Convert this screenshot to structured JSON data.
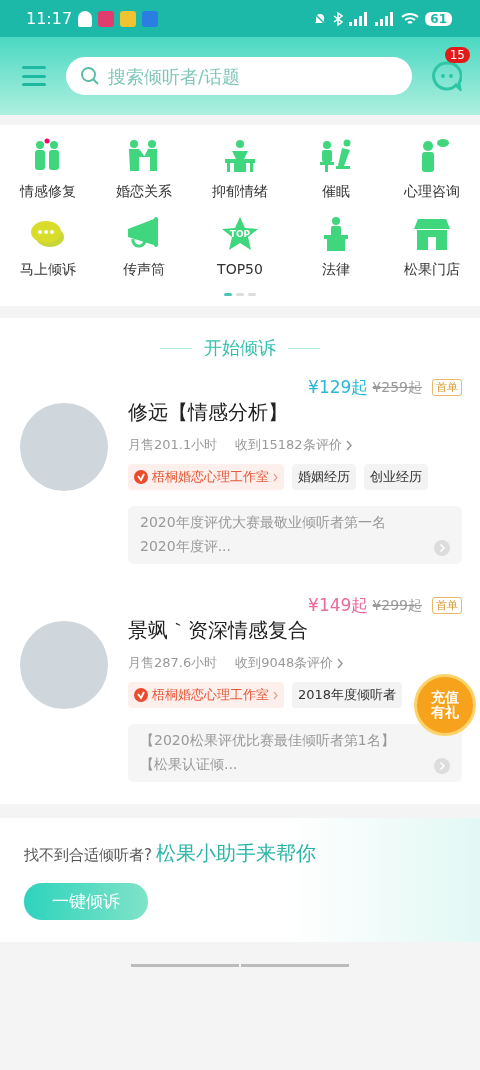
{
  "status_bar": {
    "time": "11:17",
    "battery": "61"
  },
  "header": {
    "search": {
      "placeholder": "搜索倾听者/话题"
    },
    "message_badge": "15"
  },
  "categories": [
    {
      "label": "情感修复"
    },
    {
      "label": "婚恋关系"
    },
    {
      "label": "抑郁情绪"
    },
    {
      "label": "催眠"
    },
    {
      "label": "心理咨询"
    },
    {
      "label": "马上倾诉"
    },
    {
      "label": "传声筒"
    },
    {
      "label": "TOP50",
      "icon_text": "TOP"
    },
    {
      "label": "法律"
    },
    {
      "label": "松果门店"
    }
  ],
  "pager": [
    {
      "selected": true
    },
    {
      "selected": false
    },
    {
      "selected": false
    }
  ],
  "section_title": "开始倾诉",
  "listeners": [
    {
      "price": "¥129起",
      "color": "#2bb8d6",
      "original_price": "¥259起",
      "price_badge": "首单",
      "name": "修远【情感分析】",
      "sales": "月售201.1小时",
      "reviews": "收到15182条评价",
      "org": "梧桐婚恋心理工作室",
      "tags": [
        "婚姻经历",
        "创业经历"
      ],
      "intro": [
        "2020年度评优大赛最敬业倾听者第一名",
        "2020年度评..."
      ]
    },
    {
      "price": "¥149起",
      "color": "#ec6a9a",
      "original_price": "¥299起",
      "price_badge": "首单",
      "name": "景飒｀资深情感复合",
      "sales": "月售287.6小时",
      "reviews": "收到9048条评价",
      "org": "梧桐婚恋心理工作室",
      "tags": [
        "2018年度倾听者"
      ],
      "intro": [
        "【2020松果评优比赛最佳倾听者第1名】",
        "【松果认证倾..."
      ],
      "promo": "充值有礼"
    }
  ],
  "helper": {
    "prompt": "找不到合适倾听者?",
    "highlight": "松果小助手来帮你",
    "button": "一键倾诉"
  }
}
